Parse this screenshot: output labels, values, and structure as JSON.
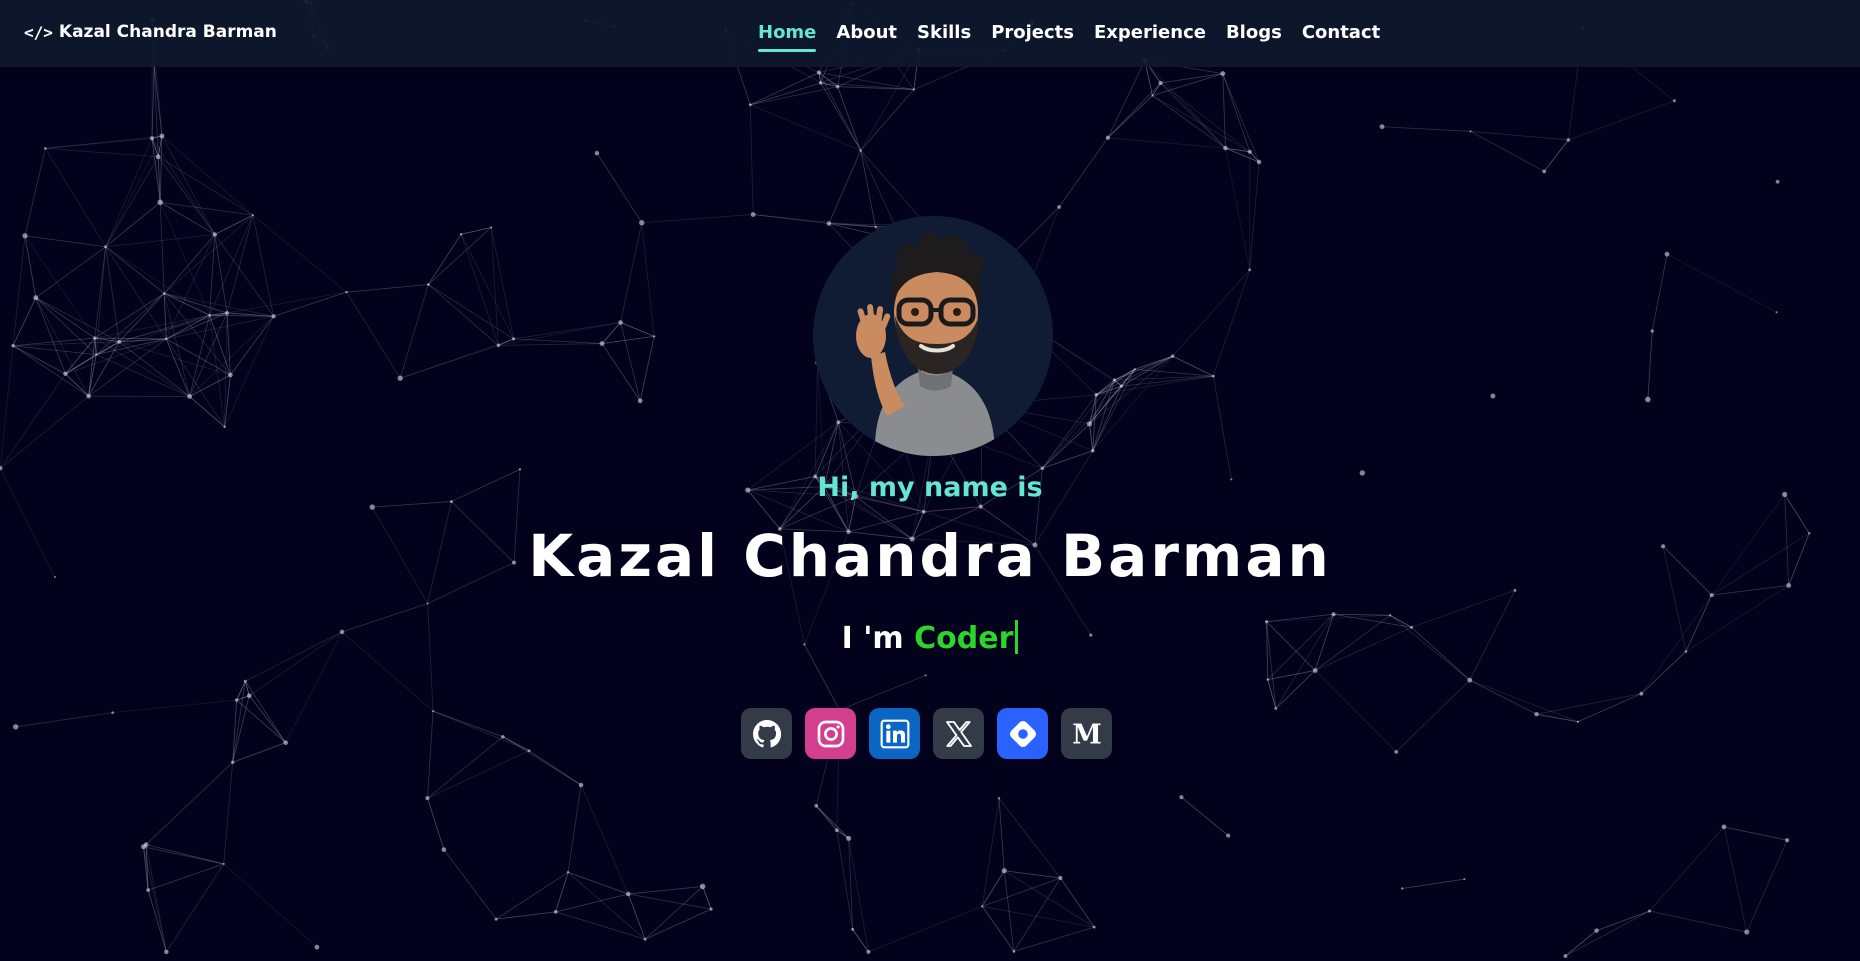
{
  "brand": {
    "icon": "code-brackets-icon",
    "icon_text": "</>",
    "name": "Kazal Chandra Barman"
  },
  "nav": {
    "items": [
      {
        "label": "Home",
        "active": true
      },
      {
        "label": "About",
        "active": false
      },
      {
        "label": "Skills",
        "active": false
      },
      {
        "label": "Projects",
        "active": false
      },
      {
        "label": "Experience",
        "active": false
      },
      {
        "label": "Blogs",
        "active": false
      },
      {
        "label": "Contact",
        "active": false
      }
    ]
  },
  "hero": {
    "avatar": "memoji-avatar-waving",
    "greeting": "Hi, my name is",
    "name": "Kazal Chandra Barman",
    "typing_prefix": "I 'm ",
    "typing_word": "Coder"
  },
  "socials": [
    {
      "name": "github",
      "icon": "github-icon",
      "color": "#323b47"
    },
    {
      "name": "instagram",
      "icon": "instagram-icon",
      "color": "#d43e8f"
    },
    {
      "name": "linkedin",
      "icon": "linkedin-icon",
      "color": "#0a66c2"
    },
    {
      "name": "x",
      "icon": "x-icon",
      "color": "#323b47"
    },
    {
      "name": "hashnode",
      "icon": "hashnode-icon",
      "color": "#2a62ff"
    },
    {
      "name": "medium",
      "icon": "medium-icon",
      "color": "#323b47"
    }
  ],
  "colors": {
    "background": "#03021d",
    "navbar": "#0e182b",
    "accent": "#64e6d4",
    "typing": "#2bd62b"
  }
}
